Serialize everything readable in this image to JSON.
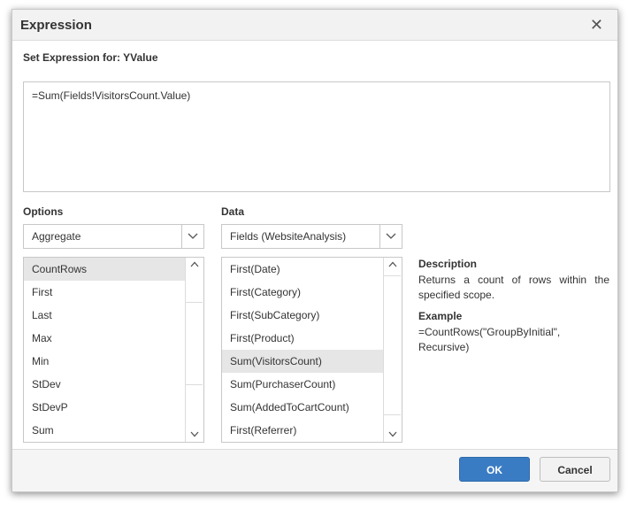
{
  "dialog": {
    "title": "Expression",
    "subtitle": "Set Expression for: YValue",
    "expression": "=Sum(Fields!VisitorsCount.Value)"
  },
  "options": {
    "label": "Options",
    "selected": "Aggregate",
    "items": [
      "CountRows",
      "First",
      "Last",
      "Max",
      "Min",
      "StDev",
      "StDevP",
      "Sum"
    ],
    "selected_item": "CountRows"
  },
  "data": {
    "label": "Data",
    "selected": "Fields (WebsiteAnalysis)",
    "items": [
      "First(Date)",
      "First(Category)",
      "First(SubCategory)",
      "First(Product)",
      "Sum(VisitorsCount)",
      "Sum(PurchaserCount)",
      "Sum(AddedToCartCount)",
      "First(Referrer)"
    ],
    "selected_item": "Sum(VisitorsCount)"
  },
  "description": {
    "heading": "Description",
    "text": "Returns a count of rows within the specified scope.",
    "example_heading": "Example",
    "example_text": "=CountRows(\"GroupByInitial\", Recursive)"
  },
  "footer": {
    "ok_label": "OK",
    "cancel_label": "Cancel"
  },
  "colors": {
    "primary_button": "#3a7cc4",
    "selected_row": "#e6e6e6"
  },
  "icons": {
    "close": "close-icon",
    "dropdown": "chevron-down-icon",
    "scroll_up": "chevron-up-icon",
    "scroll_down": "chevron-down-icon"
  }
}
